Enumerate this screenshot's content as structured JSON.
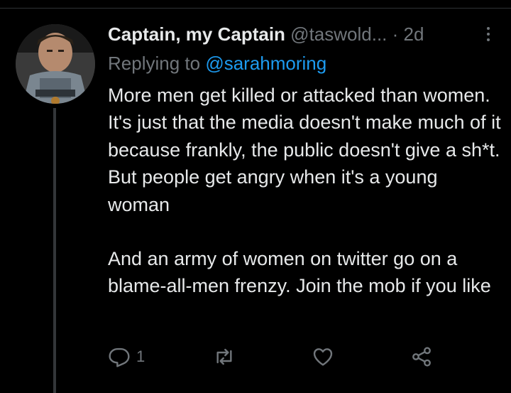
{
  "tweet": {
    "display_name": "Captain, my Captain",
    "handle": "@taswold...",
    "time_separator": "·",
    "time": "2d",
    "replying_prefix": "Replying to",
    "replying_to": "@sarahmoring",
    "paragraph_1": "More men get killed or attacked than women. It's just that the media doesn't make much of it because frankly, the public doesn't give a sh*t. But people get angry when it's a young woman",
    "paragraph_2": "And an army of women on twitter go on a blame-all-men frenzy. Join the mob if you like"
  },
  "actions": {
    "reply_count": "1"
  },
  "colors": {
    "background": "#000000",
    "text": "#e7e9ea",
    "muted": "#71767b",
    "link": "#1d9bf0"
  },
  "icons": [
    "more-icon",
    "reply-icon",
    "retweet-icon",
    "like-icon",
    "share-icon"
  ]
}
